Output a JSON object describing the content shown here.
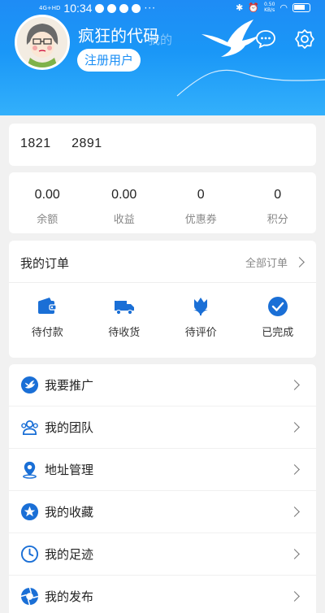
{
  "status_bar": {
    "signal": "4G+HD",
    "time": "10:34",
    "dots": "···",
    "net_speed": "0.50\nKB/s",
    "battery": "battery-icon"
  },
  "header": {
    "username": "疯狂的代码",
    "register_label": "注册用户",
    "watermark": "我的",
    "accent": "#1a8ef5"
  },
  "account": {
    "phone": "1821   2891"
  },
  "stats": [
    {
      "value": "0.00",
      "label": "余额"
    },
    {
      "value": "0.00",
      "label": "收益"
    },
    {
      "value": "0",
      "label": "优惠券"
    },
    {
      "value": "0",
      "label": "积分"
    }
  ],
  "orders": {
    "title": "我的订单",
    "all_label": "全部订单",
    "items": [
      {
        "label": "待付款",
        "icon": "wallet-icon"
      },
      {
        "label": "待收货",
        "icon": "truck-icon"
      },
      {
        "label": "待评价",
        "icon": "tulip-icon"
      },
      {
        "label": "已完成",
        "icon": "check-circle-icon"
      }
    ]
  },
  "menu": [
    {
      "label": "我要推广",
      "icon": "bird-icon"
    },
    {
      "label": "我的团队",
      "icon": "team-icon"
    },
    {
      "label": "地址管理",
      "icon": "location-pin-icon"
    },
    {
      "label": "我的收藏",
      "icon": "star-icon"
    },
    {
      "label": "我的足迹",
      "icon": "clock-icon"
    },
    {
      "label": "我的发布",
      "icon": "aperture-icon"
    }
  ]
}
